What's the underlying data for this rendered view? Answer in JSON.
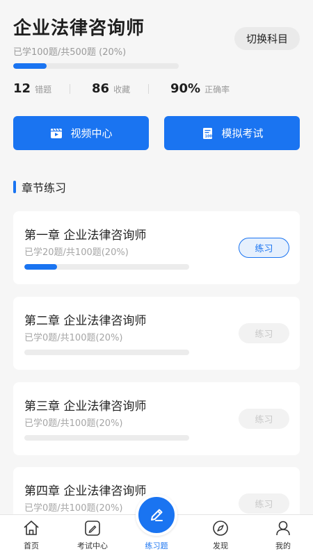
{
  "header": {
    "title": "企业法律咨询师",
    "switch_label": "切换科目",
    "progress_text": "已学100题/共500题 (20%)",
    "progress_fraction": 0.2
  },
  "stats": [
    {
      "value": "12",
      "label": "错题"
    },
    {
      "value": "86",
      "label": "收藏"
    },
    {
      "value": "90%",
      "label": "正确率"
    }
  ],
  "actions": {
    "video_label": "视频中心",
    "exam_label": "模拟考试"
  },
  "section": {
    "title": "章节练习"
  },
  "chapters": [
    {
      "title": "第一章 企业法律咨询师",
      "progress_text": "已学20题/共100题(20%)",
      "fraction": 0.2,
      "button": "练习",
      "active": true
    },
    {
      "title": "第二章 企业法律咨询师",
      "progress_text": "已学0题/共100题(20%)",
      "fraction": 0,
      "button": "练习",
      "active": false
    },
    {
      "title": "第三章 企业法律咨询师",
      "progress_text": "已学0题/共100题(20%)",
      "fraction": 0,
      "button": "练习",
      "active": false
    },
    {
      "title": "第四章 企业法律咨询师",
      "progress_text": "已学0题/共100题(20%)",
      "fraction": 0,
      "button": "练习",
      "active": false
    }
  ],
  "tabs": [
    {
      "label": "首页",
      "icon": "home-icon"
    },
    {
      "label": "考试中心",
      "icon": "exam-center-icon"
    },
    {
      "label": "练习题",
      "icon": "pencil-icon",
      "active": true
    },
    {
      "label": "发现",
      "icon": "compass-icon"
    },
    {
      "label": "我的",
      "icon": "user-icon"
    }
  ],
  "colors": {
    "accent": "#1a74f1",
    "background": "#f6f6f6"
  }
}
